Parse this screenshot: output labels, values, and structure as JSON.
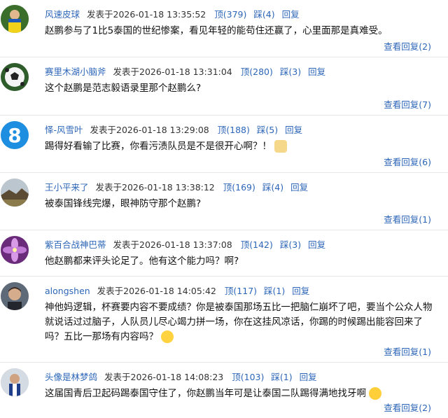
{
  "comments": [
    {
      "user": "风速皮球",
      "posted": "发表于2026-01-18 13:35:52",
      "up": "顶(379)",
      "down": "踩(4)",
      "reply": "回复",
      "text": "赵鹏参与了1比5泰国的世纪惨案，看见年轻的能苟住还赢了，心里面那是真难受。",
      "view": "查看回复(2)",
      "avatar": "soccer-player-avatar"
    },
    {
      "user": "赛里木湖小脑斧",
      "posted": "发表于2026-01-18 13:31:04",
      "up": "顶(280)",
      "down": "踩(3)",
      "reply": "回复",
      "text": "这个赵鹏是范志毅语录里那个赵鹏么?",
      "view": "查看回复(7)",
      "avatar": "soccer-ball-avatar"
    },
    {
      "user": "怿-风雪叶",
      "posted": "发表于2026-01-18 13:29:08",
      "up": "顶(188)",
      "down": "踩(5)",
      "reply": "回复",
      "text": "踢得好看输了比赛，你看污渍队员是不是很开心啊？！",
      "view": "查看回复(6)",
      "avatar": "number-8-avatar",
      "emoji": "cat-face-emoji"
    },
    {
      "user": "王小平来了",
      "posted": "发表于2026-01-18 13:38:12",
      "up": "顶(169)",
      "down": "踩(4)",
      "reply": "回复",
      "text": "被泰国锋线完爆，眼神防守那个赵鹏?",
      "view": "查看回复(1)",
      "avatar": "landscape-avatar"
    },
    {
      "user": "紫百合战神巴蒂",
      "posted": "发表于2026-01-18 13:37:08",
      "up": "顶(142)",
      "down": "踩(3)",
      "reply": "回复",
      "text": "他赵鹏都来评头论足了。他有这个能力吗？啊?",
      "view": "查看回复(1)",
      "avatar": "purple-flower-avatar"
    },
    {
      "user": "alongshen",
      "posted": "发表于2026-01-18 14:05:42",
      "up": "顶(117)",
      "down": "踩(1)",
      "reply": "回复",
      "text": "神他妈逻辑，杯赛要内容不要成绩？你是被泰国那场五比一把脑仁崩坏了吧，要当个公众人物就说话过过脑子，人队员儿尽心竭力拼一场，你在这挂风凉话，你踢的时候踢出能容回来了吗？五比一那场有内容吗？",
      "view": "查看回复(1)",
      "avatar": "man-portrait-avatar",
      "emoji": "crying-face-emoji"
    },
    {
      "user": "头像是林梦鸽",
      "posted": "发表于2026-01-18 14:08:23",
      "up": "顶(103)",
      "down": "踩(1)",
      "reply": "回复",
      "text": "这届国青后卫起码踢泰国守住了，你赵鹏当年可是让泰国二队踢得满地找牙啊",
      "view": "查看回复(2)",
      "avatar": "athlete-avatar",
      "emoji": "grinning-face-emoji"
    }
  ]
}
